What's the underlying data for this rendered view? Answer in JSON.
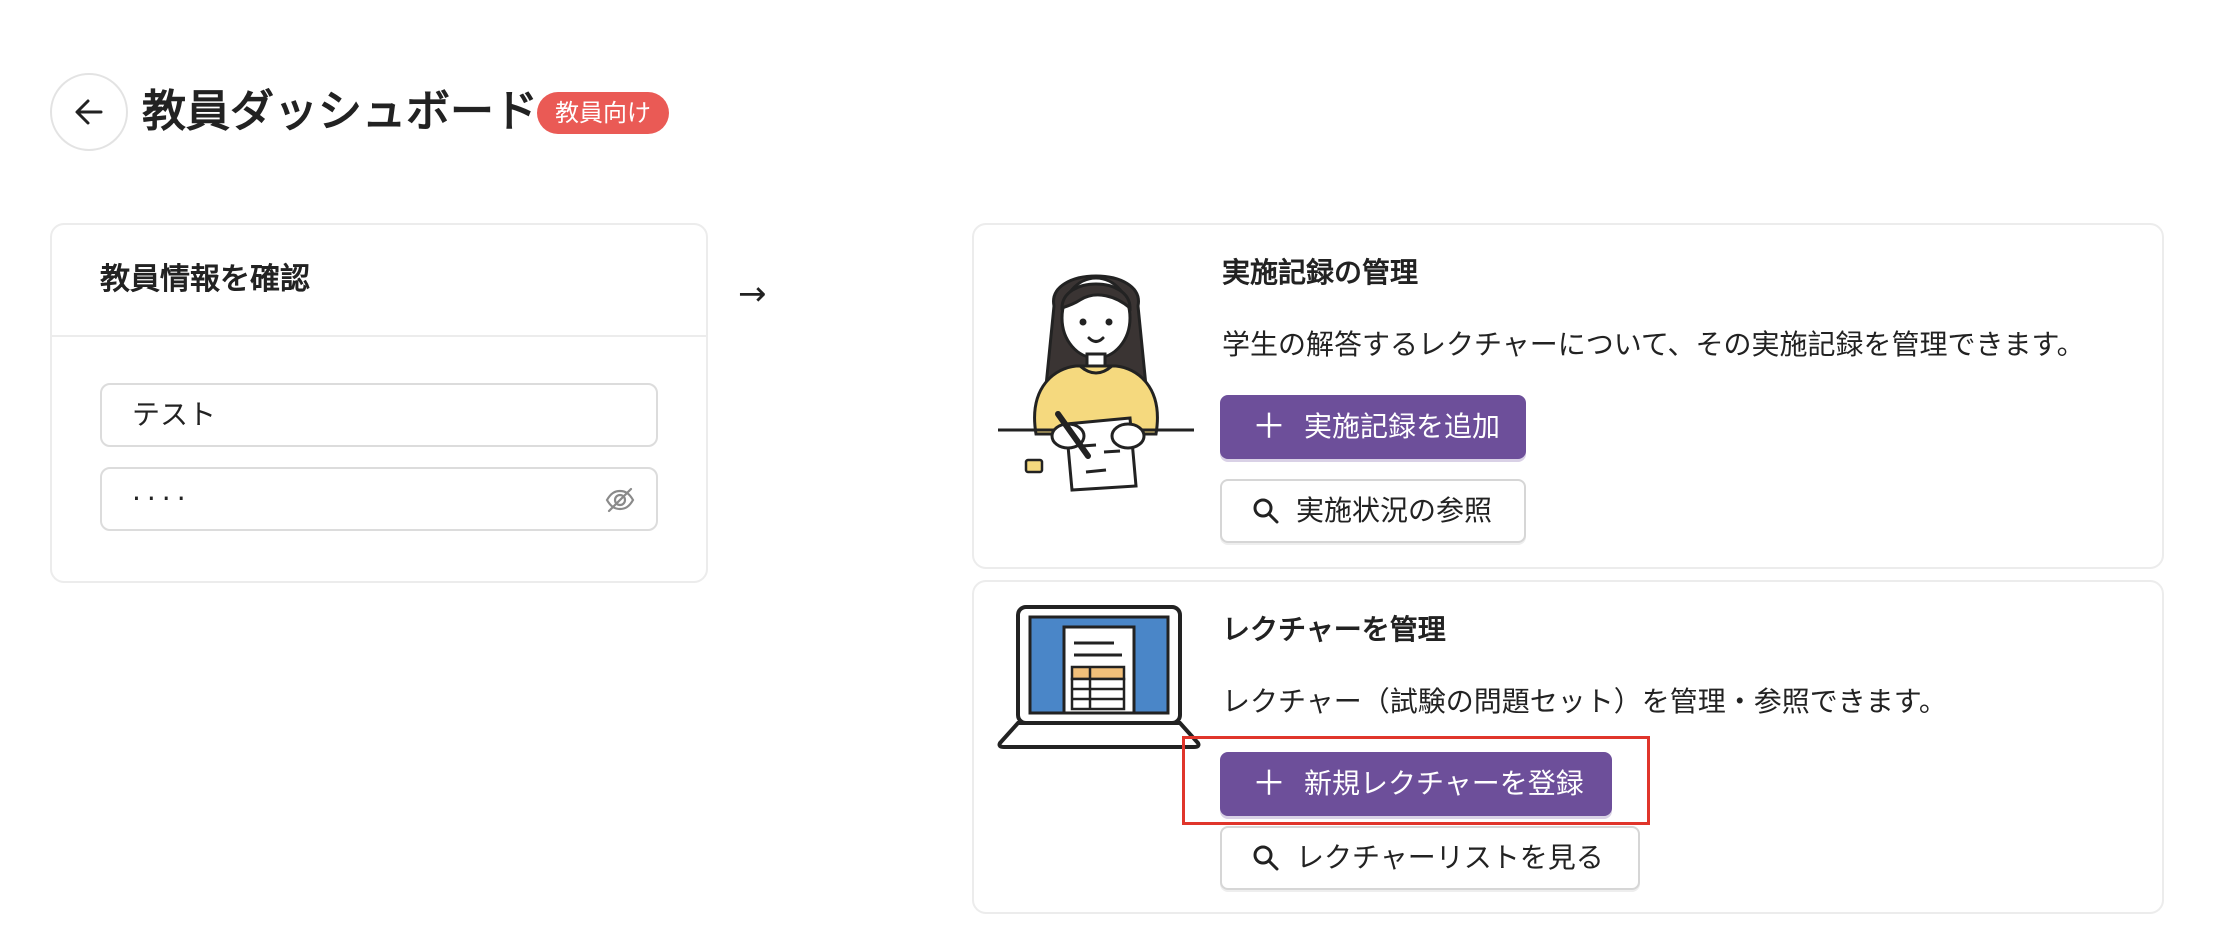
{
  "header": {
    "back_icon": "arrow-left-icon",
    "title": "教員ダッシュボード",
    "badge": "教員向け",
    "badge_color": "#ea5a55"
  },
  "teacher_info": {
    "title": "教員情報を確認",
    "name_value": "テスト",
    "password_value": "····",
    "password_toggle_icon": "eye-off-icon"
  },
  "flow_arrow": "→",
  "records": {
    "title": "実施記録の管理",
    "description": "学生の解答するレクチャーについて、その実施記録を管理できます。",
    "add_button": "実施記録を追加",
    "view_button": "実施状況の参照",
    "illustration": "student-writing-illustration"
  },
  "lectures": {
    "title": "レクチャーを管理",
    "description": "レクチャー（試験の問題セット）を管理・参照できます。",
    "register_button": "新規レクチャーを登録",
    "list_button": "レクチャーリストを見る",
    "illustration": "laptop-document-illustration"
  },
  "colors": {
    "primary": "#6d4f9a",
    "highlight": "#e0352b"
  }
}
